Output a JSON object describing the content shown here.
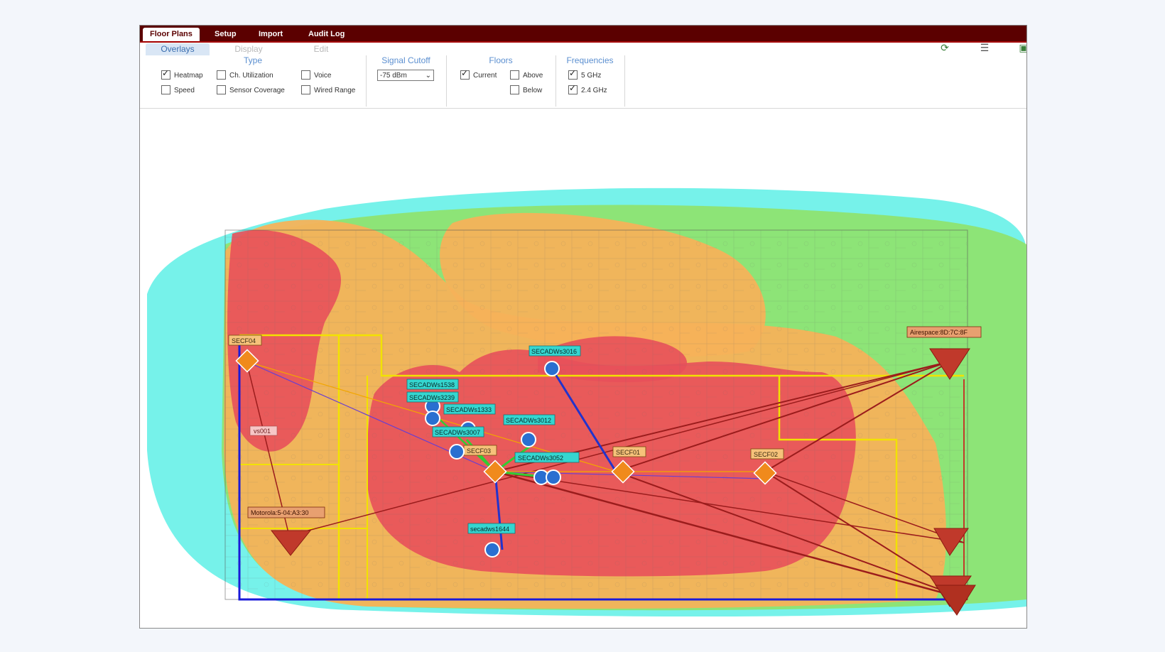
{
  "nav": {
    "tabs": [
      {
        "label": "Floor Plans"
      },
      {
        "label": "Setup"
      },
      {
        "label": "Import"
      },
      {
        "label": "Audit Log"
      }
    ]
  },
  "subnav": {
    "tabs": [
      {
        "label": "Overlays"
      },
      {
        "label": "Display"
      },
      {
        "label": "Edit"
      }
    ]
  },
  "toolbar": {
    "icons": [
      "refresh-icon",
      "list-icon",
      "export-icon"
    ]
  },
  "options": {
    "type": {
      "title": "Type",
      "items": [
        {
          "label": "Heatmap",
          "checked": true
        },
        {
          "label": "Ch. Utilization",
          "checked": false
        },
        {
          "label": "Voice",
          "checked": false
        },
        {
          "label": "Speed",
          "checked": false
        },
        {
          "label": "Sensor Coverage",
          "checked": false
        },
        {
          "label": "Wired Range",
          "checked": false
        }
      ]
    },
    "signal_cutoff": {
      "title": "Signal Cutoff",
      "value": "-75 dBm"
    },
    "floors": {
      "title": "Floors",
      "items": [
        {
          "label": "Current",
          "checked": true
        },
        {
          "label": "Above",
          "checked": false
        },
        {
          "label": "Below",
          "checked": false
        }
      ]
    },
    "frequencies": {
      "title": "Frequencies",
      "items": [
        {
          "label": "5 GHz",
          "checked": true
        },
        {
          "label": "2.4 GHz",
          "checked": true
        }
      ]
    }
  },
  "map": {
    "access_points": [
      {
        "label": "SECF04"
      },
      {
        "label": "SECF03"
      },
      {
        "label": "SECF01"
      },
      {
        "label": "SECF02"
      }
    ],
    "clients": [
      {
        "label": "SECADWs3016"
      },
      {
        "label": "SECADWs1538"
      },
      {
        "label": "SECADWs3239"
      },
      {
        "label": "SECADWs1333"
      },
      {
        "label": "SECADWs3012"
      },
      {
        "label": "SECADWs3007"
      },
      {
        "label": "SECADWs3052"
      },
      {
        "label": "secadws1644"
      }
    ],
    "sensors": [
      {
        "label": "Airespace:8D:7C:8F"
      },
      {
        "label": "Motorola:5-04:A3:30"
      }
    ],
    "room_label": "vs001",
    "colors": {
      "heat_strong": "#e8505a",
      "heat_good": "#f5b25a",
      "heat_fair": "#90e26a",
      "heat_weak": "#5ef0e6",
      "boundary_yellow": "#f2e200",
      "boundary_blue": "#1a1ad8",
      "link_red": "#9b1c1c",
      "link_blue": "#2233cc",
      "link_green": "#33cc33",
      "ap_orange": "#f08a1c",
      "label_bg": "#f6c27a",
      "client_label_bg": "#35d6d0"
    }
  }
}
